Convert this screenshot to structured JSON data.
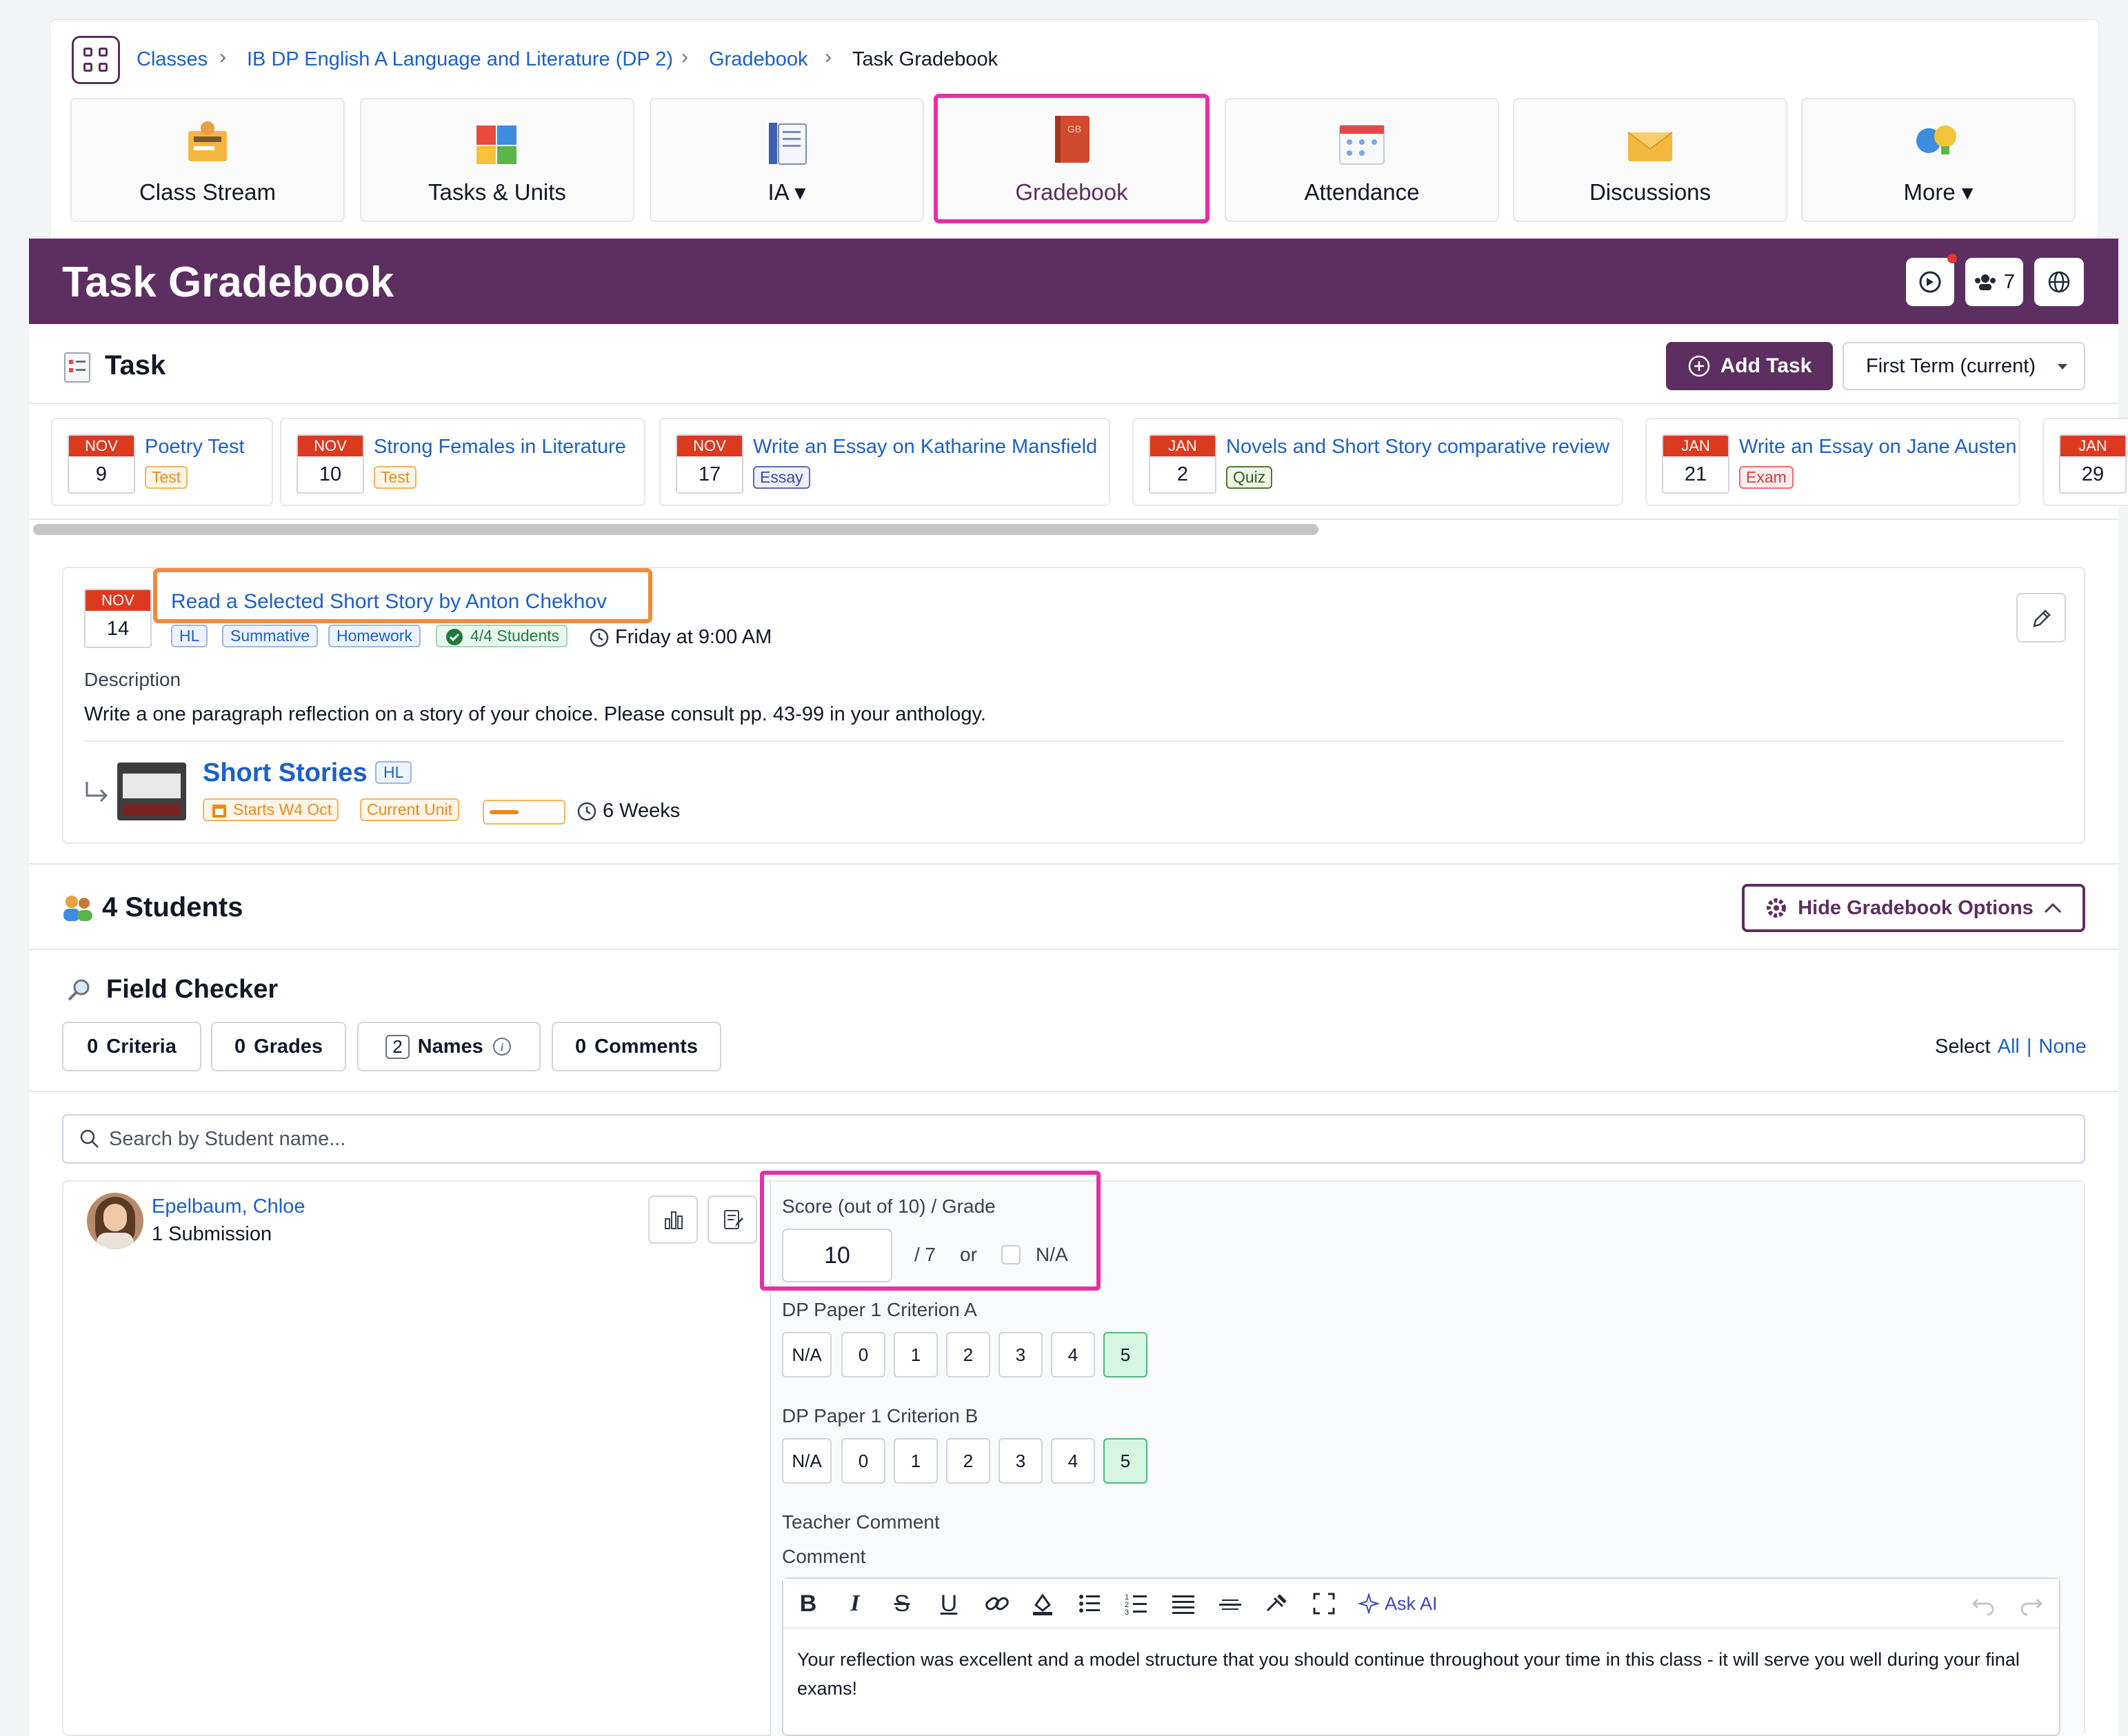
{
  "breadcrumb": {
    "items": [
      "Classes",
      "IB DP English A Language and Literature (DP 2)",
      "Gradebook"
    ],
    "current": "Task Gradebook"
  },
  "nav": {
    "tiles": [
      {
        "label": "Class Stream",
        "icon": "class-stream-icon"
      },
      {
        "label": "Tasks & Units",
        "icon": "puzzle-icon"
      },
      {
        "label": "IA ▾",
        "icon": "ia-icon"
      },
      {
        "label": "Gradebook",
        "icon": "gradebook-book-icon",
        "icon_text": "GB",
        "active": true
      },
      {
        "label": "Attendance",
        "icon": "calendar-icon"
      },
      {
        "label": "Discussions",
        "icon": "envelope-icon"
      },
      {
        "label": "More ▾",
        "icon": "more-icon"
      }
    ]
  },
  "header": {
    "title": "Task Gradebook",
    "students_count": "7"
  },
  "task_section": {
    "title": "Task",
    "add_task_label": "Add Task",
    "term_label": "First Term (current)"
  },
  "task_strip": [
    {
      "month": "NOV",
      "day": "9",
      "name": "Poetry Test",
      "tag": "Test",
      "tag_style": "test"
    },
    {
      "month": "NOV",
      "day": "10",
      "name": "Strong Females in Literature",
      "tag": "Test",
      "tag_style": "test"
    },
    {
      "month": "NOV",
      "day": "17",
      "name": "Write an Essay on Katharine Mansfield",
      "tag": "Essay",
      "tag_style": "essay"
    },
    {
      "month": "JAN",
      "day": "2",
      "name": "Novels and Short Story comparative review",
      "tag": "Quiz",
      "tag_style": "quiz"
    },
    {
      "month": "JAN",
      "day": "21",
      "name": "Write an Essay on Jane Austen",
      "tag": "Exam",
      "tag_style": "exam"
    },
    {
      "month": "JAN",
      "day": "29",
      "name": "",
      "tag": "",
      "tag_style": ""
    }
  ],
  "task_detail": {
    "month": "NOV",
    "day": "14",
    "title": "Read a Selected Short Story by Anton Chekhov",
    "chips": [
      "HL",
      "Summative",
      "Homework"
    ],
    "students_done": "4/4 Students",
    "due": "Friday at 9:00 AM",
    "description_label": "Description",
    "description": "Write a one paragraph reflection on a story of your choice. Please consult pp. 43-99 in your anthology.",
    "unit": {
      "name": "Short Stories",
      "level": "HL",
      "starts": "Starts W4 Oct",
      "status": "Current Unit",
      "progress": 0.4,
      "duration": "6 Weeks"
    }
  },
  "students": {
    "heading": "4 Students",
    "hide_options_label": "Hide Gradebook Options",
    "field_checker": {
      "title": "Field Checker",
      "buttons": [
        {
          "count": "0",
          "label": "Criteria"
        },
        {
          "count": "0",
          "label": "Grades"
        },
        {
          "count": "2",
          "label": "Names"
        },
        {
          "count": "0",
          "label": "Comments"
        }
      ],
      "select_label": "Select",
      "all": "All",
      "separator": "|",
      "none": "None"
    },
    "search_placeholder": "Search by Student name..."
  },
  "student": {
    "name": "Epelbaum, Chloe",
    "submissions": "1 Submission",
    "score_label": "Score (out of 10) / Grade",
    "score_value": "10",
    "grade_text": "/ 7",
    "or_text": "or",
    "na_label": "N/A",
    "criteria": [
      {
        "label": "DP Paper 1 Criterion A",
        "levels": [
          "N/A",
          "0",
          "1",
          "2",
          "3",
          "4",
          "5"
        ],
        "selected": "5"
      },
      {
        "label": "DP Paper 1 Criterion B",
        "levels": [
          "N/A",
          "0",
          "1",
          "2",
          "3",
          "4",
          "5"
        ],
        "selected": "5"
      }
    ],
    "teacher_comment_label": "Teacher Comment",
    "comment_label": "Comment",
    "ask_ai_label": "Ask AI",
    "comment_text": "Your reflection was excellent and a model structure that you should continue throughout your time in this class - it will serve you well during your final exams!"
  },
  "colors": {
    "brand_purple": "#5c2f60",
    "highlight_pink": "#e62fa6",
    "highlight_orange": "#f08a3c",
    "link_blue": "#1d5fc9",
    "date_red": "#dc3a1f"
  }
}
